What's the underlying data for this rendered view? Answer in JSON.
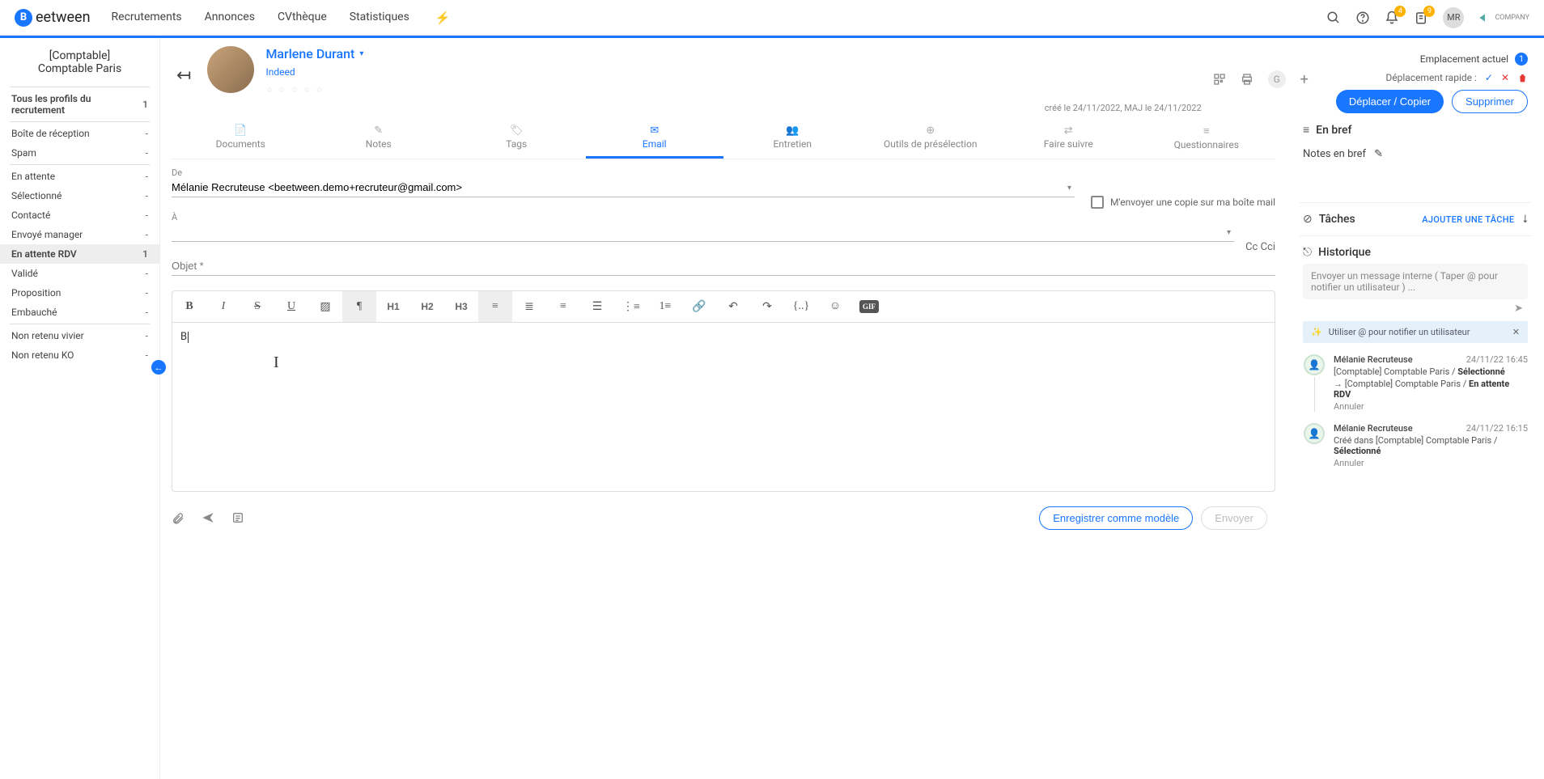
{
  "topnav": {
    "logo": "eetween",
    "items": [
      "Recrutements",
      "Annonces",
      "CVthèque",
      "Statistiques"
    ],
    "notif_badge": "4",
    "assign_badge": "9",
    "user_initials": "MR",
    "company": "COMPANY"
  },
  "sidebar": {
    "title_line1": "[Comptable]",
    "title_line2": "Comptable Paris",
    "all_profiles": {
      "label": "Tous les profils du recrutement",
      "count": "1"
    },
    "group1": [
      {
        "label": "Boîte de réception",
        "count": "-"
      },
      {
        "label": "Spam",
        "count": "-"
      }
    ],
    "group2": [
      {
        "label": "En attente",
        "count": "-"
      },
      {
        "label": "Sélectionné",
        "count": "-"
      },
      {
        "label": "Contacté",
        "count": "-"
      },
      {
        "label": "Envoyé manager",
        "count": "-"
      },
      {
        "label": "En attente RDV",
        "count": "1"
      },
      {
        "label": "Validé",
        "count": "-"
      },
      {
        "label": "Proposition",
        "count": "-"
      },
      {
        "label": "Embauché",
        "count": "-"
      }
    ],
    "group3": [
      {
        "label": "Non retenu vivier",
        "count": "-"
      },
      {
        "label": "Non retenu KO",
        "count": "-"
      }
    ]
  },
  "profile": {
    "name": "Marlene Durant",
    "source": "Indeed",
    "dates": "créé le 24/11/2022, MAJ le 24/11/2022",
    "location_label": "Emplacement actuel",
    "location_badge": "1",
    "quickmove_label": "Déplacement rapide :",
    "btn_move": "Déplacer / Copier",
    "btn_delete": "Supprimer"
  },
  "tabs": [
    "Documents",
    "Notes",
    "Tags",
    "Email",
    "Entretien",
    "Outils de présélection",
    "Faire suivre",
    "Questionnaires"
  ],
  "email": {
    "from_label": "De",
    "from_value": "Mélanie Recruteuse <beetween.demo+recruteur@gmail.com>",
    "copy_label": "M'envoyer une copie sur ma boîte mail",
    "to_label": "À",
    "cc": "Cc Cci",
    "subject_label": "Objet *",
    "body": "B",
    "save_template": "Enregistrer comme modèle",
    "send": "Envoyer"
  },
  "right": {
    "brief": "En bref",
    "notes_label": "Notes en bref",
    "tasks": "Tâches",
    "add_task": "AJOUTER UNE TÂCHE",
    "history": "Historique",
    "msg_placeholder": "Envoyer un message interne ( Taper @ pour notifier un utilisateur ) ...",
    "tip": "Utiliser @ pour notifier un utilisateur",
    "tl1": {
      "name": "Mélanie Recruteuse",
      "time": "24/11/22 16:45",
      "line1a": "[Comptable] Comptable Paris / ",
      "line1b": "Sélectionné",
      "line2a": "→ [Comptable] Comptable Paris / ",
      "line2b": "En attente RDV",
      "cancel": "Annuler"
    },
    "tl2": {
      "name": "Mélanie Recruteuse",
      "time": "24/11/22 16:15",
      "line1a": "Créé dans [Comptable] Comptable Paris / ",
      "line1b": "Sélectionné",
      "cancel": "Annuler"
    }
  }
}
